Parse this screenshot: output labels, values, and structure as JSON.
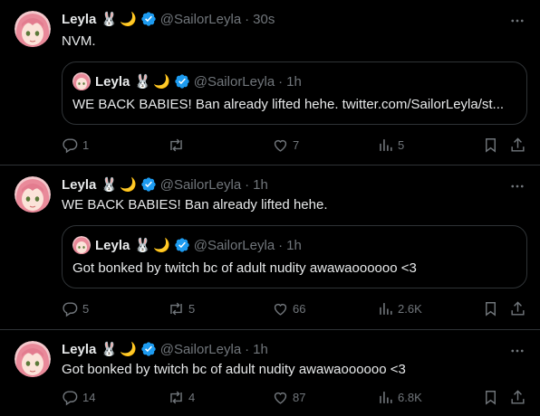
{
  "tweets": [
    {
      "name": "Leyla",
      "emoji": [
        "🐰",
        "🌙"
      ],
      "handle": "@SailorLeyla",
      "time": "30s",
      "text": "NVM.",
      "quote": {
        "name": "Leyla",
        "handle": "@SailorLeyla",
        "time": "1h",
        "text": "WE BACK BABIES! Ban already lifted hehe. twitter.com/SailorLeyla/st..."
      },
      "replies": "1",
      "retweets": "",
      "likes": "7",
      "views": "5"
    },
    {
      "name": "Leyla",
      "emoji": [
        "🐰",
        "🌙"
      ],
      "handle": "@SailorLeyla",
      "time": "1h",
      "text": "WE BACK BABIES! Ban already lifted hehe.",
      "quote": {
        "name": "Leyla",
        "handle": "@SailorLeyla",
        "time": "1h",
        "text": "Got bonked by twitch bc of adult nudity awawaoooooo <3"
      },
      "replies": "5",
      "retweets": "5",
      "likes": "66",
      "views": "2.6K"
    },
    {
      "name": "Leyla",
      "emoji": [
        "🐰",
        "🌙"
      ],
      "handle": "@SailorLeyla",
      "time": "1h",
      "text": "Got bonked by twitch bc of adult nudity awawaoooooo <3",
      "replies": "14",
      "retweets": "4",
      "likes": "87",
      "views": "6.8K"
    }
  ],
  "colors": {
    "background": "#000000",
    "text": "#e7e9ea",
    "muted": "#71767b",
    "border": "#2f3336",
    "verified": "#1d9bf0"
  },
  "icons": [
    "more-icon",
    "verified-badge-icon",
    "reply-icon",
    "retweet-icon",
    "like-icon",
    "views-icon",
    "bookmark-icon",
    "share-icon"
  ]
}
